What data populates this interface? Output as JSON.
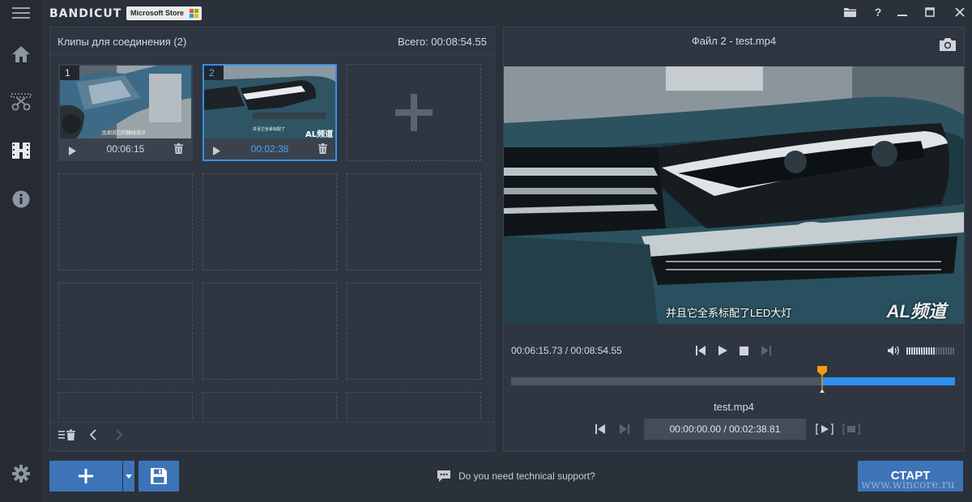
{
  "app": {
    "logo_prefix": "BANDI",
    "logo_suffix": "CUT",
    "store_badge": "Microsoft Store"
  },
  "sidebar": {
    "items": [
      "menu-icon",
      "home-icon",
      "cut-icon",
      "join-icon",
      "info-icon",
      "settings-icon"
    ]
  },
  "clips_panel": {
    "title": "Клипы для соединения (2)",
    "total": "Всего: 00:08:54.55",
    "clips": [
      {
        "number": "1",
        "duration": "00:06:15",
        "selected": false,
        "caption": "比如说它的腰线设计"
      },
      {
        "number": "2",
        "duration": "00:02:38",
        "selected": true,
        "caption": "AL频道"
      }
    ]
  },
  "preview": {
    "title": "Файл 2 - test.mp4",
    "subtitle": "并且它全系标配了LED大灯",
    "watermark": "AL频道",
    "timecode": "00:06:15.73 / 00:08:54.55",
    "volume_level": 0.6,
    "playhead_fraction": 0.7,
    "file_label": "test.mp4",
    "range": "00:00:00.00 / 00:02:38.81"
  },
  "bottom": {
    "support_text": "Do you need technical support?",
    "start_label": "СТАРТ",
    "watermark_site": "www.wincore.ru"
  },
  "colors": {
    "accent": "#3d74b8",
    "selection": "#3a8ee6",
    "timeline_fill": "#2e8ff0",
    "playhead": "#f39c12"
  }
}
